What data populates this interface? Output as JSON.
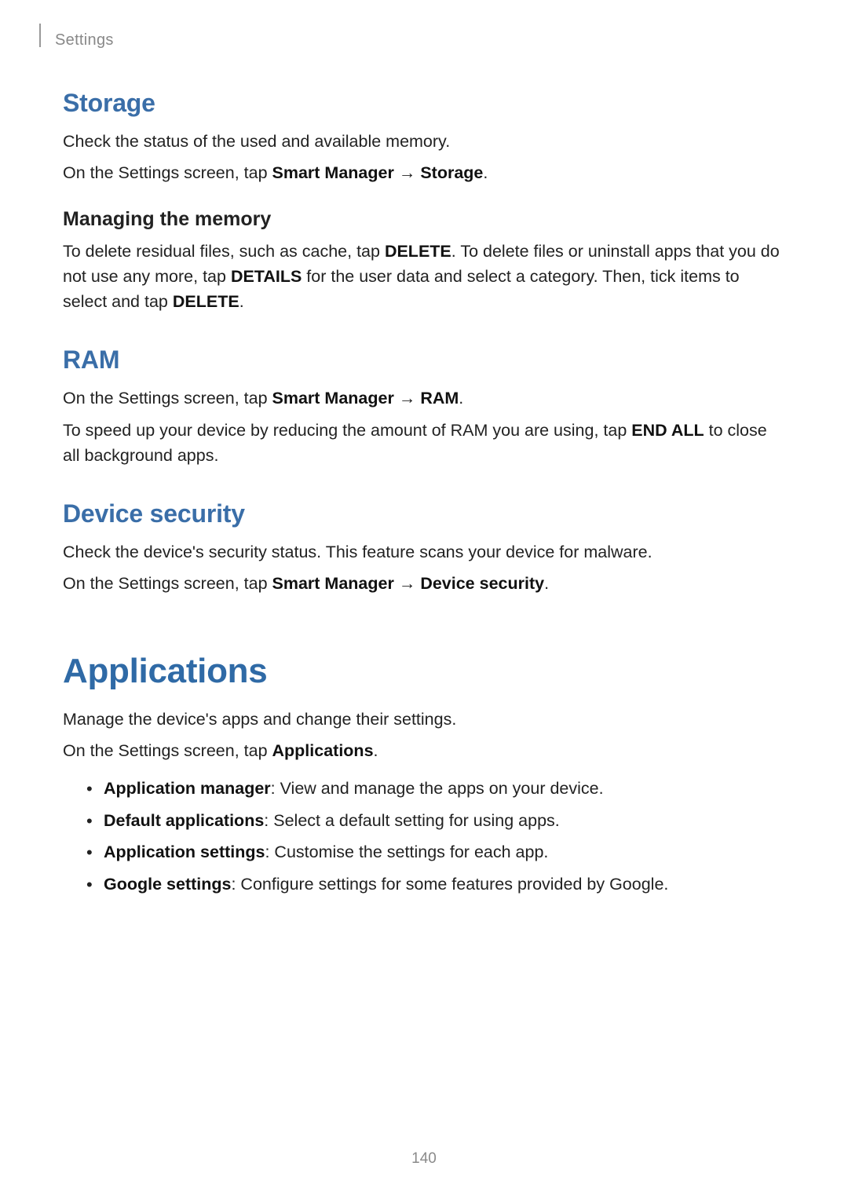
{
  "header": {
    "section": "Settings"
  },
  "storage": {
    "heading": "Storage",
    "p1": "Check the status of the used and available memory.",
    "p2_prefix": "On the Settings screen, tap ",
    "p2_b1": "Smart Manager",
    "p2_arrow": " → ",
    "p2_b2": "Storage",
    "p2_suffix": ".",
    "managing_heading": "Managing the memory",
    "managing_a": "To delete residual files, such as cache, tap ",
    "managing_b1": "DELETE",
    "managing_mid": ". To delete files or uninstall apps that you do not use any more, tap ",
    "managing_b2": "DETAILS",
    "managing_c": " for the user data and select a category. Then, tick items to select and tap ",
    "managing_b3": "DELETE",
    "managing_end": "."
  },
  "ram": {
    "heading": "RAM",
    "p1_prefix": "On the Settings screen, tap ",
    "p1_b1": "Smart Manager",
    "p1_arrow": " → ",
    "p1_b2": "RAM",
    "p1_suffix": ".",
    "p2_a": "To speed up your device by reducing the amount of RAM you are using, tap ",
    "p2_b": "END ALL",
    "p2_c": " to close all background apps."
  },
  "security": {
    "heading": "Device security",
    "p1": "Check the device's security status. This feature scans your device for malware.",
    "p2_prefix": "On the Settings screen, tap ",
    "p2_b1": "Smart Manager",
    "p2_arrow": " → ",
    "p2_b2": "Device security",
    "p2_suffix": "."
  },
  "applications": {
    "chapter": "Applications",
    "p1": "Manage the device's apps and change their settings.",
    "p2_prefix": "On the Settings screen, tap ",
    "p2_b": "Applications",
    "p2_suffix": ".",
    "items": [
      {
        "term": "Application manager",
        "desc": ": View and manage the apps on your device."
      },
      {
        "term": "Default applications",
        "desc": ": Select a default setting for using apps."
      },
      {
        "term": "Application settings",
        "desc": ": Customise the settings for each app."
      },
      {
        "term": "Google settings",
        "desc": ": Configure settings for some features provided by Google."
      }
    ]
  },
  "page_number": "140"
}
